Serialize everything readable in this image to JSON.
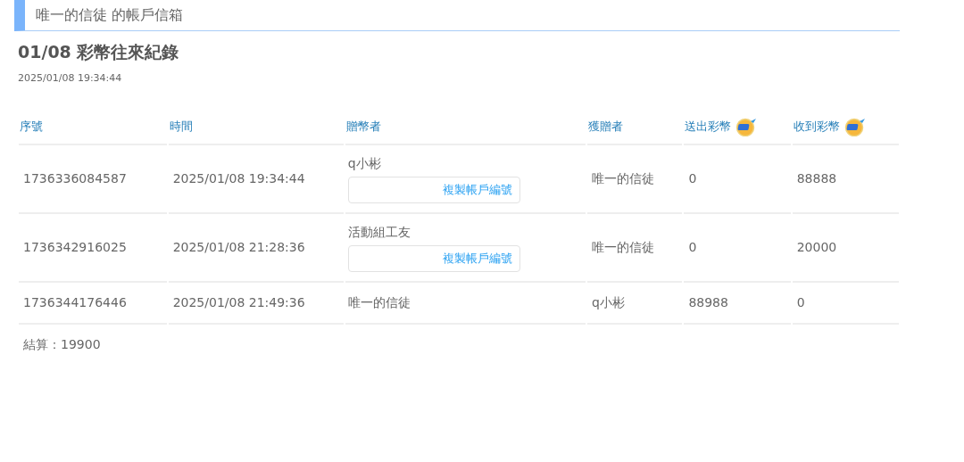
{
  "header": {
    "title": "唯一的信徒 的帳戶信箱"
  },
  "record": {
    "title": "01/08 彩幣往來紀錄",
    "timestamp": "2025/01/08 19:34:44"
  },
  "table": {
    "columns": [
      {
        "label": "序號",
        "coin_icon": false
      },
      {
        "label": "時間",
        "coin_icon": false
      },
      {
        "label": "贈幣者",
        "coin_icon": false
      },
      {
        "label": "獲贈者",
        "coin_icon": false
      },
      {
        "label": "送出彩幣",
        "coin_icon": true
      },
      {
        "label": "收到彩幣",
        "coin_icon": true
      }
    ],
    "rows": [
      {
        "serial": "1736336084587",
        "time": "2025/01/08 19:34:44",
        "sender": "q小彬",
        "copy_button": "複製帳戶編號",
        "recipient": "唯一的信徒",
        "sent": "0",
        "received": "88888"
      },
      {
        "serial": "1736342916025",
        "time": "2025/01/08 21:28:36",
        "sender": "活動組工友",
        "copy_button": "複製帳戶編號",
        "recipient": "唯一的信徒",
        "sent": "0",
        "received": "20000"
      },
      {
        "serial": "1736344176446",
        "time": "2025/01/08 21:49:36",
        "sender": "唯一的信徒",
        "recipient": "q小彬",
        "sent": "88988",
        "received": "0"
      }
    ]
  },
  "summary": "結算：19900"
}
